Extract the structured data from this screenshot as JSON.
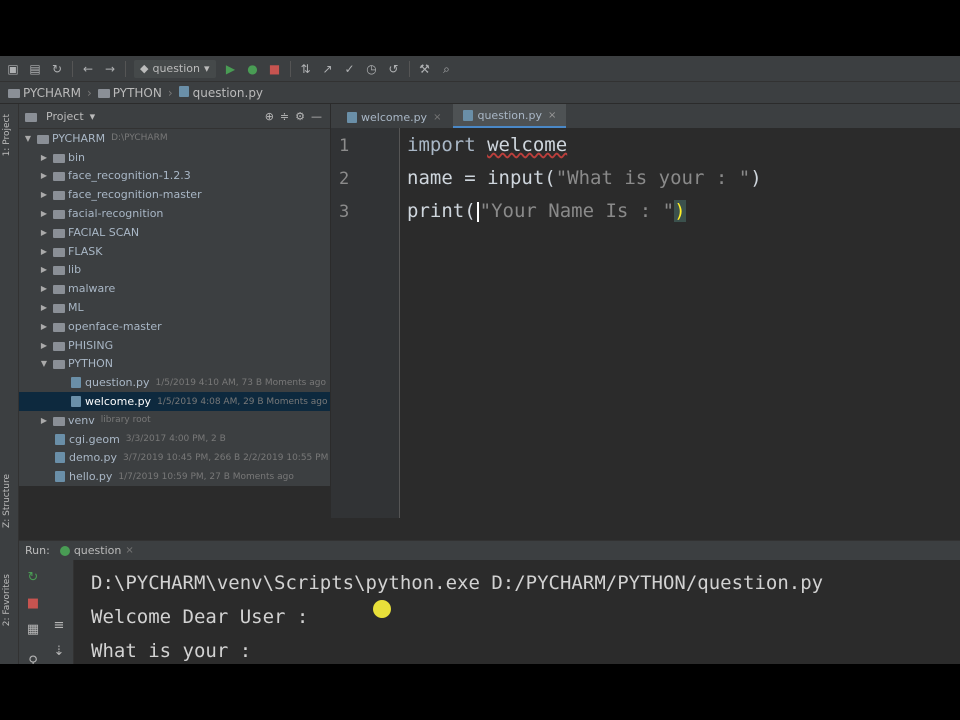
{
  "toolbar": {
    "run_config": "question",
    "icons": [
      "open-icon",
      "save-icon",
      "sync-icon",
      "back-icon",
      "forward-icon",
      "run-config-icon",
      "run-icon",
      "debug-icon",
      "stop-icon",
      "vcs-icon",
      "commit-icon",
      "check-icon",
      "history-icon",
      "revert-icon",
      "wrench-icon",
      "search-icon"
    ]
  },
  "breadcrumb": {
    "root": "PYCHARM",
    "folder": "PYTHON",
    "file": "question.py"
  },
  "left_strip": {
    "project_tab": "1: Project",
    "structure_tab": "Z: Structure",
    "favorites_tab": "2: Favorites"
  },
  "project_panel": {
    "title": "Project",
    "root": "PYCHARM",
    "root_path": "D:\\PYCHARM",
    "items": [
      {
        "label": "bin",
        "type": "folder",
        "expanded": false
      },
      {
        "label": "face_recognition-1.2.3",
        "type": "folder",
        "expanded": false
      },
      {
        "label": "face_recognition-master",
        "type": "folder",
        "expanded": false
      },
      {
        "label": "facial-recognition",
        "type": "folder",
        "expanded": false
      },
      {
        "label": "FACIAL SCAN",
        "type": "folder",
        "expanded": false
      },
      {
        "label": "FLASK",
        "type": "folder",
        "expanded": false
      },
      {
        "label": "lib",
        "type": "folder",
        "expanded": false
      },
      {
        "label": "malware",
        "type": "folder",
        "expanded": false
      },
      {
        "label": "ML",
        "type": "folder",
        "expanded": false
      },
      {
        "label": "openface-master",
        "type": "folder",
        "expanded": false
      },
      {
        "label": "PHISING",
        "type": "folder",
        "expanded": false
      },
      {
        "label": "PYTHON",
        "type": "folder",
        "expanded": true
      },
      {
        "label": "question.py",
        "type": "file",
        "meta": "1/5/2019 4:10 AM, 73 B  Moments ago"
      },
      {
        "label": "welcome.py",
        "type": "file",
        "meta": "1/5/2019 4:08 AM, 29 B  Moments ago"
      },
      {
        "label": "venv",
        "type": "folder",
        "expanded": false,
        "meta": "library root"
      },
      {
        "label": "cgi.geom",
        "type": "file",
        "meta": "3/3/2017 4:00 PM, 2 B"
      },
      {
        "label": "demo.py",
        "type": "file",
        "meta": "3/7/2019 10:45 PM, 266 B  2/2/2019 10:55 PM"
      },
      {
        "label": "hello.py",
        "type": "file",
        "meta": "1/7/2019 10:59 PM, 27 B  Moments ago"
      }
    ]
  },
  "editor": {
    "tabs": [
      {
        "label": "welcome.py",
        "active": false
      },
      {
        "label": "question.py",
        "active": true
      }
    ],
    "line_numbers": [
      "1",
      "2",
      "3"
    ],
    "lines": {
      "l1_kw": "import",
      "l1_mod": "welcome",
      "l2_pre": "name = input(",
      "l2_str": "\"What is your : \"",
      "l2_post": ")",
      "l3_pre": "print(",
      "l3_str": "\"Your Name Is : \"",
      "l3_post": ")"
    }
  },
  "run_panel": {
    "run_label": "Run:",
    "tab_label": "question",
    "console": [
      "D:\\PYCHARM\\venv\\Scripts\\python.exe D:/PYCHARM/PYTHON/question.py",
      "Welcome Dear User :",
      "What is your :"
    ]
  },
  "colors": {
    "background": "#2b2b2b",
    "panel": "#3c3f41",
    "selection": "#0d293e",
    "brace_highlight": "#ffef28"
  }
}
